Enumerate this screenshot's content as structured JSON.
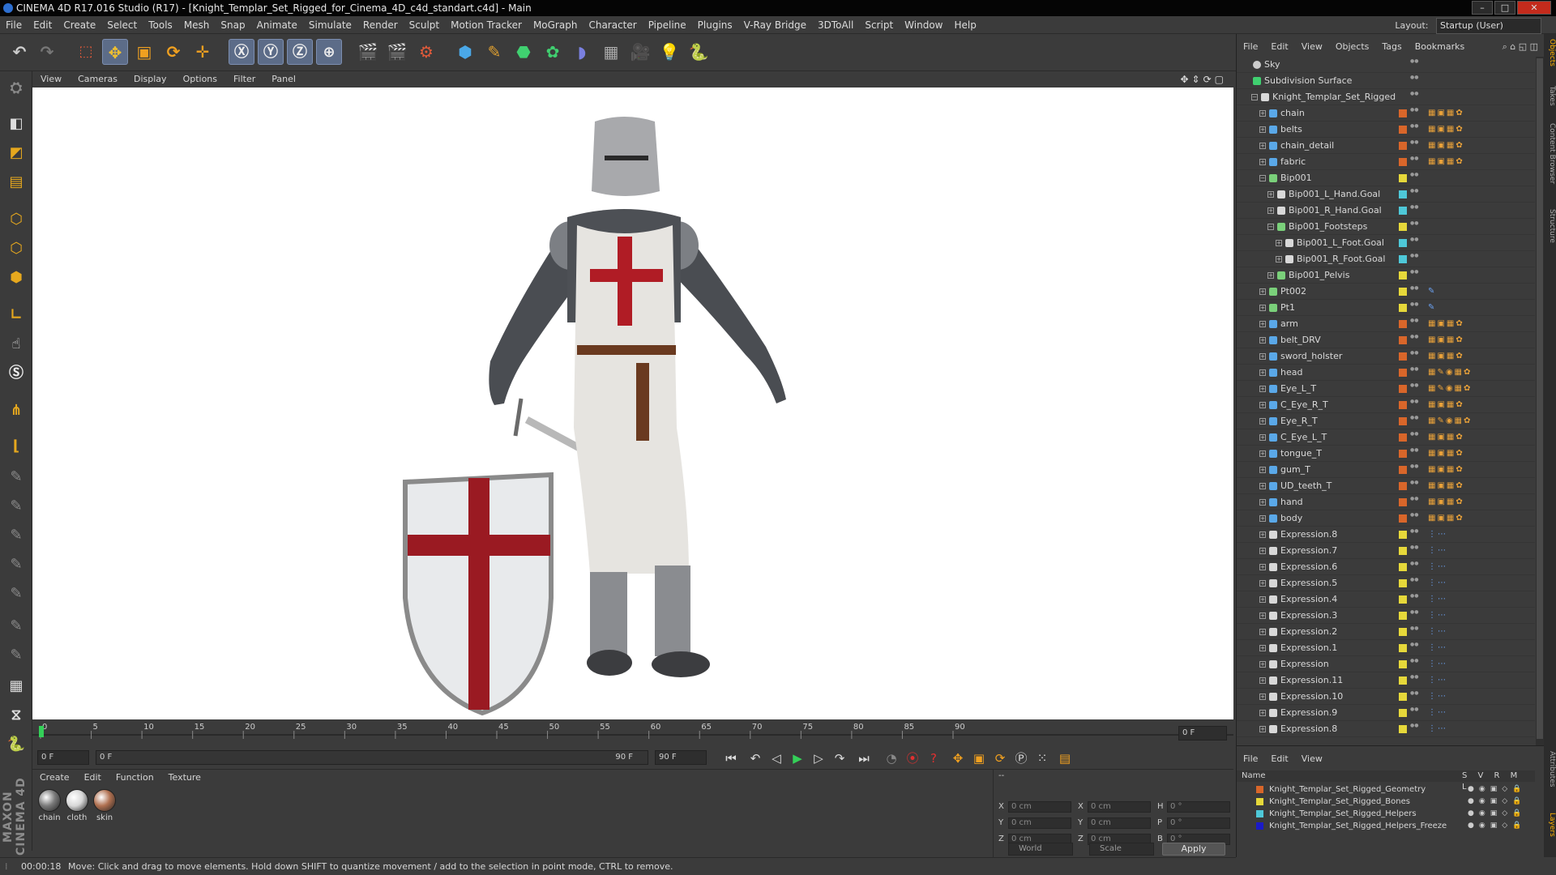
{
  "title": "CINEMA 4D R17.016 Studio (R17) - [Knight_Templar_Set_Rigged_for_Cinema_4D_c4d_standart.c4d] - Main",
  "menu": [
    "File",
    "Edit",
    "Create",
    "Select",
    "Tools",
    "Mesh",
    "Snap",
    "Animate",
    "Simulate",
    "Render",
    "Sculpt",
    "Motion Tracker",
    "MoGraph",
    "Character",
    "Pipeline",
    "Plugins",
    "V-Ray Bridge",
    "3DToAll",
    "Script",
    "Window",
    "Help"
  ],
  "layout": {
    "label": "Layout:",
    "value": "Startup (User)"
  },
  "viewport_menu": [
    "View",
    "Cameras",
    "Display",
    "Options",
    "Filter",
    "Panel"
  ],
  "timeline": {
    "ticks": [
      "0",
      "5",
      "10",
      "15",
      "20",
      "25",
      "30",
      "35",
      "40",
      "45",
      "50",
      "55",
      "60",
      "65",
      "70",
      "75",
      "80",
      "85",
      "90"
    ],
    "current_frame": "0 F",
    "start": "0 F",
    "slider_start": "0 F",
    "slider_end": "90 F",
    "end": "90 F"
  },
  "materials": {
    "menu": [
      "Create",
      "Edit",
      "Function",
      "Texture"
    ],
    "items": [
      {
        "name": "chain",
        "color": "#7a7a7a"
      },
      {
        "name": "cloth",
        "color": "#d8d8d8"
      },
      {
        "name": "skin",
        "color": "#b07050"
      }
    ]
  },
  "coords": {
    "rows": [
      {
        "a": "X",
        "av": "0 cm",
        "b": "X",
        "bv": "0 cm",
        "c": "H",
        "cv": "0 °"
      },
      {
        "a": "Y",
        "av": "0 cm",
        "b": "Y",
        "bv": "0 cm",
        "c": "P",
        "cv": "0 °"
      },
      {
        "a": "Z",
        "av": "0 cm",
        "b": "Z",
        "bv": "0 cm",
        "c": "B",
        "cv": "0 °"
      }
    ],
    "world": "World",
    "scale": "Scale",
    "apply": "Apply",
    "header": "--"
  },
  "status": {
    "time": "00:00:18",
    "message": "Move: Click and drag to move elements. Hold down SHIFT to quantize movement / add to the selection in point mode, CTRL to remove."
  },
  "objects_menu": [
    "File",
    "Edit",
    "View",
    "Objects",
    "Tags",
    "Bookmarks"
  ],
  "objects": [
    {
      "name": "Sky",
      "indent": 0,
      "icon": "sky",
      "layer": "",
      "tags": ""
    },
    {
      "name": "Subdivision Surface",
      "indent": 0,
      "icon": "subdiv",
      "layer": "",
      "tags": "",
      "expanded": true
    },
    {
      "name": "Knight_Templar_Set_Rigged",
      "indent": 1,
      "icon": "null",
      "layer": "",
      "tags": "",
      "expanded": true
    },
    {
      "name": "chain",
      "indent": 2,
      "icon": "mesh",
      "layer": "#d9662a",
      "tags": "tex"
    },
    {
      "name": "belts",
      "indent": 2,
      "icon": "mesh",
      "layer": "#d9662a",
      "tags": "tex"
    },
    {
      "name": "chain_detail",
      "indent": 2,
      "icon": "mesh",
      "layer": "#d9662a",
      "tags": "tex"
    },
    {
      "name": "fabric",
      "indent": 2,
      "icon": "mesh",
      "layer": "#d9662a",
      "tags": "tex"
    },
    {
      "name": "Bip001",
      "indent": 2,
      "icon": "bone",
      "layer": "#e6d83a",
      "tags": "",
      "expanded": true
    },
    {
      "name": "Bip001_L_Hand.Goal",
      "indent": 3,
      "icon": "null",
      "layer": "#4ec8d8",
      "tags": ""
    },
    {
      "name": "Bip001_R_Hand.Goal",
      "indent": 3,
      "icon": "null",
      "layer": "#4ec8d8",
      "tags": ""
    },
    {
      "name": "Bip001_Footsteps",
      "indent": 3,
      "icon": "bone",
      "layer": "#e6d83a",
      "tags": "",
      "expanded": true
    },
    {
      "name": "Bip001_L_Foot.Goal",
      "indent": 4,
      "icon": "null",
      "layer": "#4ec8d8",
      "tags": ""
    },
    {
      "name": "Bip001_R_Foot.Goal",
      "indent": 4,
      "icon": "null",
      "layer": "#4ec8d8",
      "tags": ""
    },
    {
      "name": "Bip001_Pelvis",
      "indent": 3,
      "icon": "bone",
      "layer": "#e6d83a",
      "tags": ""
    },
    {
      "name": "Pt002",
      "indent": 2,
      "icon": "bone",
      "layer": "#e6d83a",
      "tags": "ik"
    },
    {
      "name": "Pt1",
      "indent": 2,
      "icon": "bone",
      "layer": "#e6d83a",
      "tags": "ik"
    },
    {
      "name": "arm",
      "indent": 2,
      "icon": "mesh",
      "layer": "#d9662a",
      "tags": "tex"
    },
    {
      "name": "belt_DRV",
      "indent": 2,
      "icon": "mesh",
      "layer": "#d9662a",
      "tags": "tex"
    },
    {
      "name": "sword_holster",
      "indent": 2,
      "icon": "mesh",
      "layer": "#d9662a",
      "tags": "tex"
    },
    {
      "name": "head",
      "indent": 2,
      "icon": "mesh",
      "layer": "#d9662a",
      "tags": "tex2"
    },
    {
      "name": "Eye_L_T",
      "indent": 2,
      "icon": "mesh",
      "layer": "#d9662a",
      "tags": "tex2"
    },
    {
      "name": "C_Eye_R_T",
      "indent": 2,
      "icon": "mesh",
      "layer": "#d9662a",
      "tags": "tex"
    },
    {
      "name": "Eye_R_T",
      "indent": 2,
      "icon": "mesh",
      "layer": "#d9662a",
      "tags": "tex2"
    },
    {
      "name": "C_Eye_L_T",
      "indent": 2,
      "icon": "mesh",
      "layer": "#d9662a",
      "tags": "tex"
    },
    {
      "name": "tongue_T",
      "indent": 2,
      "icon": "mesh",
      "layer": "#d9662a",
      "tags": "tex"
    },
    {
      "name": "gum_T",
      "indent": 2,
      "icon": "mesh",
      "layer": "#d9662a",
      "tags": "tex"
    },
    {
      "name": "UD_teeth_T",
      "indent": 2,
      "icon": "mesh",
      "layer": "#d9662a",
      "tags": "tex"
    },
    {
      "name": "hand",
      "indent": 2,
      "icon": "mesh",
      "layer": "#d9662a",
      "tags": "tex"
    },
    {
      "name": "body",
      "indent": 2,
      "icon": "mesh",
      "layer": "#d9662a",
      "tags": "tex"
    },
    {
      "name": "Expression.8",
      "indent": 2,
      "icon": "null",
      "layer": "#e6d83a",
      "tags": "xp"
    },
    {
      "name": "Expression.7",
      "indent": 2,
      "icon": "null",
      "layer": "#e6d83a",
      "tags": "xp"
    },
    {
      "name": "Expression.6",
      "indent": 2,
      "icon": "null",
      "layer": "#e6d83a",
      "tags": "xp"
    },
    {
      "name": "Expression.5",
      "indent": 2,
      "icon": "null",
      "layer": "#e6d83a",
      "tags": "xp"
    },
    {
      "name": "Expression.4",
      "indent": 2,
      "icon": "null",
      "layer": "#e6d83a",
      "tags": "xp"
    },
    {
      "name": "Expression.3",
      "indent": 2,
      "icon": "null",
      "layer": "#e6d83a",
      "tags": "xp"
    },
    {
      "name": "Expression.2",
      "indent": 2,
      "icon": "null",
      "layer": "#e6d83a",
      "tags": "xp"
    },
    {
      "name": "Expression.1",
      "indent": 2,
      "icon": "null",
      "layer": "#e6d83a",
      "tags": "xp"
    },
    {
      "name": "Expression",
      "indent": 2,
      "icon": "null",
      "layer": "#e6d83a",
      "tags": "xp"
    },
    {
      "name": "Expression.11",
      "indent": 2,
      "icon": "null",
      "layer": "#e6d83a",
      "tags": "xp"
    },
    {
      "name": "Expression.10",
      "indent": 2,
      "icon": "null",
      "layer": "#e6d83a",
      "tags": "xp"
    },
    {
      "name": "Expression.9",
      "indent": 2,
      "icon": "null",
      "layer": "#e6d83a",
      "tags": "xp"
    },
    {
      "name": "Expression.8",
      "indent": 2,
      "icon": "null",
      "layer": "#e6d83a",
      "tags": "xp"
    }
  ],
  "layers_menu": [
    "File",
    "Edit",
    "View"
  ],
  "layers_header": {
    "name": "Name",
    "flags": "S V R M L"
  },
  "layers": [
    {
      "name": "Knight_Templar_Set_Rigged_Geometry",
      "color": "#d9662a"
    },
    {
      "name": "Knight_Templar_Set_Rigged_Bones",
      "color": "#e6d83a"
    },
    {
      "name": "Knight_Templar_Set_Rigged_Helpers",
      "color": "#4ec8d8"
    },
    {
      "name": "Knight_Templar_Set_Rigged_Helpers_Freeze",
      "color": "#1a1ac8"
    }
  ],
  "side_tabs": [
    "Objects",
    "Takes",
    "Content Browser",
    "Structure",
    "Attributes",
    "Layers"
  ],
  "brand": "MAXON CINEMA 4D"
}
